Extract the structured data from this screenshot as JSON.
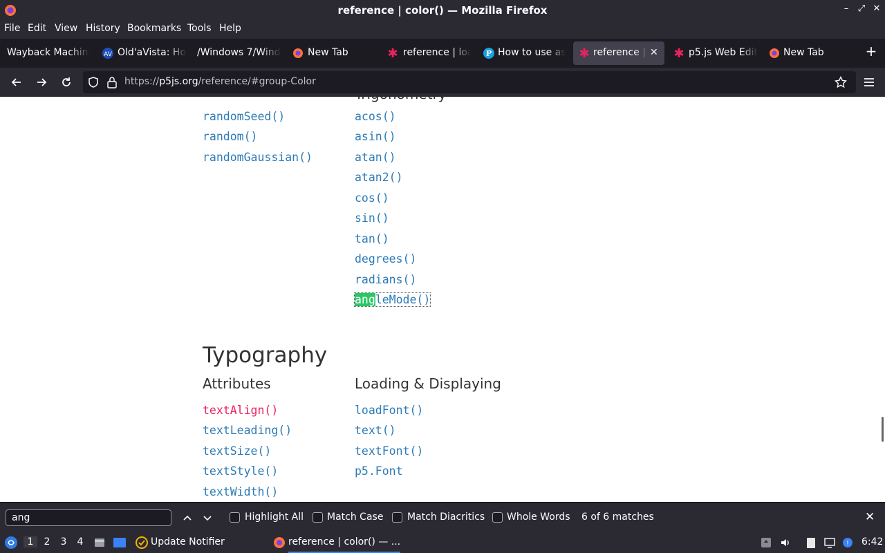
{
  "window": {
    "title": "reference | color() — Mozilla Firefox"
  },
  "menu": [
    "File",
    "Edit",
    "View",
    "History",
    "Bookmarks",
    "Tools",
    "Help"
  ],
  "tabs": [
    {
      "label": "Wayback Machine",
      "icon": "wayback-icon"
    },
    {
      "label": "Old'aVista: Ho",
      "icon": "oldavista-icon"
    },
    {
      "label": "/Windows 7/Wind",
      "icon": "none"
    },
    {
      "label": "New Tab",
      "icon": "firefox-icon"
    },
    {
      "label": "reference | loa",
      "icon": "p5js-star-icon"
    },
    {
      "label": "How to use as",
      "icon": "pinterest-icon"
    },
    {
      "label": "reference | c",
      "icon": "p5js-star-icon",
      "active": true
    },
    {
      "label": "p5.js Web Edit",
      "icon": "p5js-star-icon"
    },
    {
      "label": "New Tab",
      "icon": "firefox-icon"
    }
  ],
  "url": {
    "prefix": "https://",
    "host": "p5js.org",
    "path": "/reference/#group-Color"
  },
  "content": {
    "left_col": [
      "randomSeed()",
      "random()",
      "randomGaussian()"
    ],
    "right_col": [
      "acos()",
      "asin()",
      "atan()",
      "atan2()",
      "cos()",
      "sin()",
      "tan()",
      "degrees()",
      "radians()"
    ],
    "angle_match": "ang",
    "angle_rest": "leMode()",
    "typography": {
      "title": "Typography",
      "attributes_heading": "Attributes",
      "loading_heading": "Loading & Displaying",
      "attributes": [
        "textAlign()",
        "textLeading()",
        "textSize()",
        "textStyle()",
        "textWidth()"
      ],
      "loading": [
        "loadFont()",
        "text()",
        "textFont()",
        "p5.Font"
      ]
    }
  },
  "findbar": {
    "query": "ang",
    "highlight_all": "Highlight All",
    "match_case": "Match Case",
    "match_diacritics": "Match Diacritics",
    "whole_words": "Whole Words",
    "status": "6 of 6 matches"
  },
  "taskbar": {
    "workspaces": [
      "1",
      "2",
      "3",
      "4"
    ],
    "update_notifier": "Update Notifier",
    "firefox_task": "reference | color() — ...",
    "clock": "6:42"
  },
  "colors": {
    "link": "#2d7bb6",
    "active_link": "#ed225d",
    "find_highlight": "#2ac864",
    "chrome_dark": "#2b2a33"
  }
}
